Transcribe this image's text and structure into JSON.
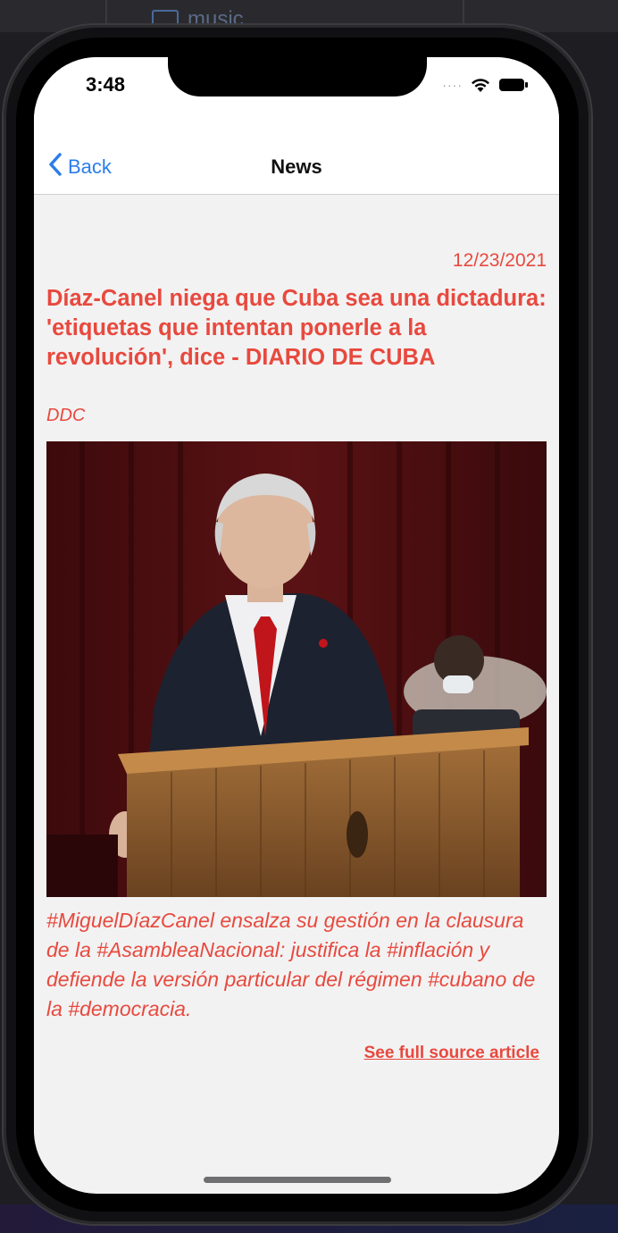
{
  "background": {
    "folder_label": "music"
  },
  "status_bar": {
    "time": "3:48",
    "signal_icon": "signal-dots-icon",
    "wifi_icon": "wifi-icon",
    "battery_icon": "battery-icon"
  },
  "nav": {
    "back_label": "Back",
    "title": "News"
  },
  "article": {
    "date": "12/23/2021",
    "headline": "Díaz-Canel niega que Cuba sea una dictadura: 'etiquetas que intentan ponerle a la revolución', dice - DIARIO DE CUBA",
    "source": "DDC",
    "description": "#MiguelDíazCanel ensalza su gestión en la clausura de la #AsambleaNacional: justifica la #inflación y defiende la versión particular del régimen #cubano de la #democracia.",
    "link_label": "See full source article"
  },
  "colors": {
    "accent": "#e8493e",
    "link_blue": "#2b7de9",
    "background": "#f2f2f2"
  }
}
